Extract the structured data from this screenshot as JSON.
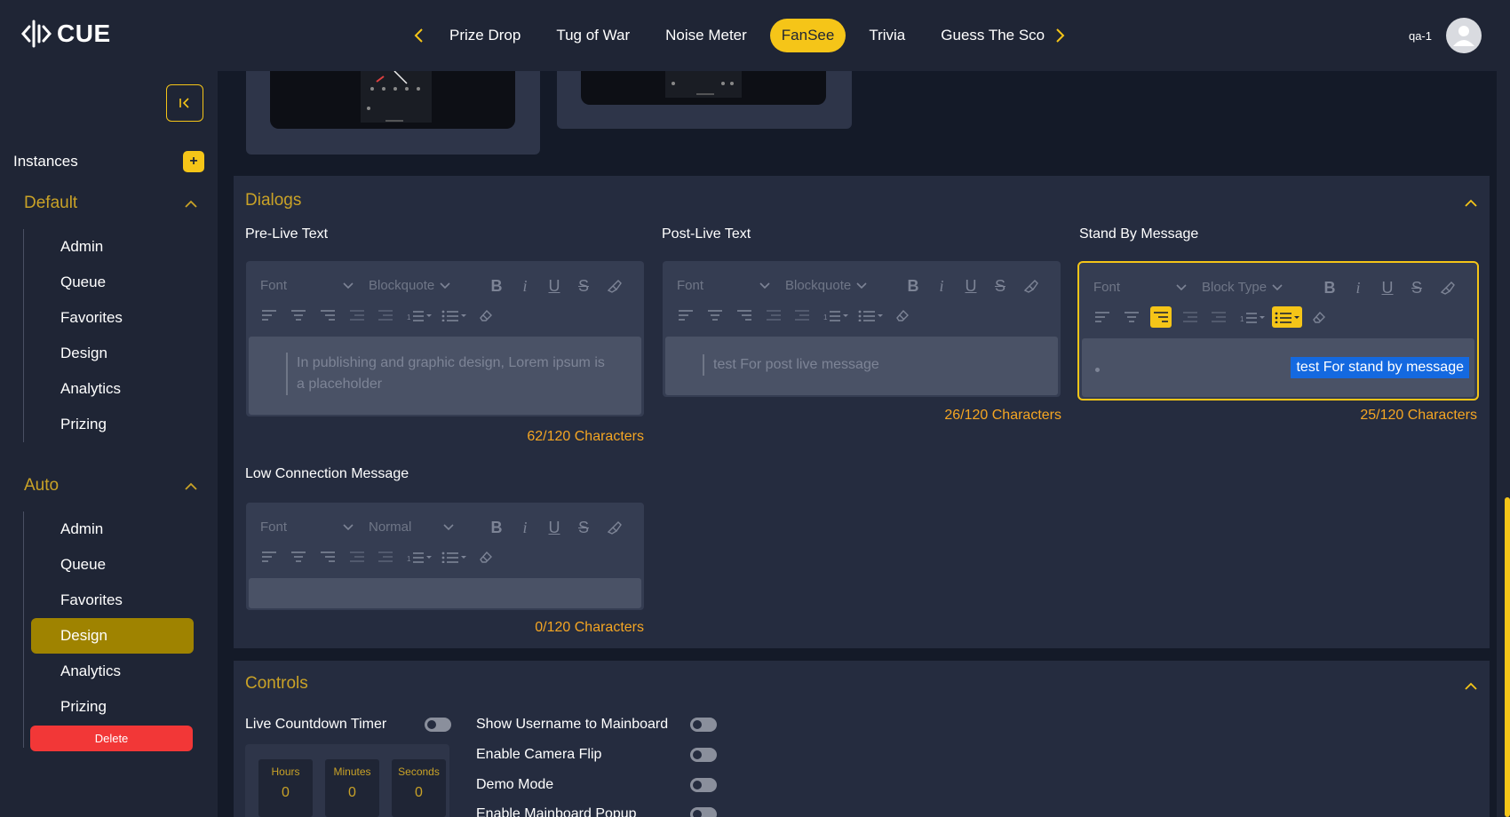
{
  "brand": {
    "name": "CUE"
  },
  "nav": {
    "tabs": [
      "Prize Drop",
      "Tug of War",
      "Noise Meter",
      "FanSee",
      "Trivia",
      "Guess The Sco"
    ],
    "active": "FanSee"
  },
  "user": {
    "name": "qa-1"
  },
  "sidebar": {
    "instances_label": "Instances",
    "groups": [
      {
        "title": "Default",
        "items": [
          "Admin",
          "Queue",
          "Favorites",
          "Design",
          "Analytics",
          "Prizing"
        ]
      },
      {
        "title": "Auto",
        "items": [
          "Admin",
          "Queue",
          "Favorites",
          "Design",
          "Analytics",
          "Prizing"
        ],
        "active_item": "Design"
      }
    ],
    "delete_label": "Delete"
  },
  "dialogs": {
    "title": "Dialogs",
    "pre_live": {
      "label": "Pre-Live Text",
      "font": "Font",
      "block": "Blockquote",
      "text": "In publishing and graphic design, Lorem ipsum is a placeholder",
      "counter": "62/120 Characters"
    },
    "post_live": {
      "label": "Post-Live Text",
      "font": "Font",
      "block": "Blockquote",
      "text": "test For post live message",
      "counter": "26/120 Characters"
    },
    "stand_by": {
      "label": "Stand By Message",
      "font": "Font",
      "block": "Block Type",
      "text": "test For stand by message",
      "counter": "25/120 Characters"
    },
    "low_connection": {
      "label": "Low Connection Message",
      "font": "Font",
      "block": "Normal",
      "text": "",
      "counter": "0/120 Characters"
    }
  },
  "controls": {
    "title": "Controls",
    "live_countdown_label": "Live Countdown Timer",
    "timer": {
      "hours_label": "Hours",
      "minutes_label": "Minutes",
      "seconds_label": "Seconds",
      "hours": "0",
      "minutes": "0",
      "seconds": "0"
    },
    "toggles": [
      "Show Username to Mainboard",
      "Enable Camera Flip",
      "Demo Mode",
      "Enable Mainboard Popup"
    ]
  },
  "colors": {
    "accent": "#f5c518",
    "danger": "#f23737",
    "counter": "#f5a623",
    "section_title": "#c9a227"
  }
}
